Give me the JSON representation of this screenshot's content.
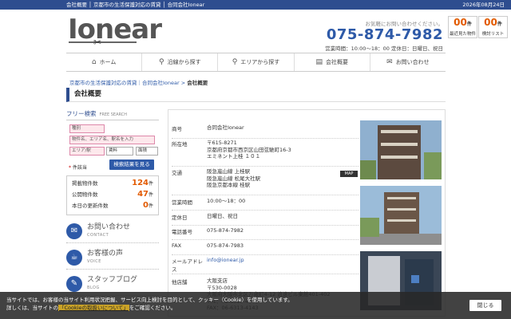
{
  "topbar": {
    "links": "会社概要 │ 京都市の生活保護対応の賃貸 │ 合同会社Ionear",
    "date": "2026年08月24日"
  },
  "logo": {
    "text": "Ionear"
  },
  "contact": {
    "pre": "お気軽にお問い合わせください。",
    "phone": "075-874-7982",
    "hours": "営業時間：10:00〜18：00 定休日：日曜日、祝日"
  },
  "header_buttons": [
    {
      "count": "00",
      "unit": "件",
      "label": "最近見た物件"
    },
    {
      "count": "00",
      "unit": "件",
      "label": "検討リスト"
    }
  ],
  "nav": [
    {
      "label": "ホーム",
      "icon": "home-icon"
    },
    {
      "label": "沿線から探す",
      "icon": "search-icon"
    },
    {
      "label": "エリアから探す",
      "icon": "search-icon"
    },
    {
      "label": "会社概要",
      "icon": "building-icon"
    },
    {
      "label": "お問い合わせ",
      "icon": "mail-icon"
    }
  ],
  "breadcrumb": {
    "link": "京都市の生活保護対応の賃貸｜合同会社Ionear",
    "sep": ">",
    "current": "会社概要"
  },
  "page_title": "会社概要",
  "search": {
    "title": "フリー検索",
    "title_en": "FREE SEARCH",
    "type_ph": "種別",
    "keyword_ph": "物件名、エリア名、駅名を入力",
    "area_ph": "エリア/駅",
    "rent": "賃料",
    "layout": "面積",
    "required_mark": "*",
    "required": "件該当",
    "button": "検索結果を見る"
  },
  "stats": [
    {
      "label": "掲載物件数",
      "value": "124",
      "unit": "件"
    },
    {
      "label": "公開物件数",
      "value": "47",
      "unit": "件"
    },
    {
      "label": "本日の更新件数",
      "value": "0",
      "unit": "件"
    }
  ],
  "side_links": [
    {
      "title": "お問い合わせ",
      "sub": "CONTACT",
      "icon": "mail-icon"
    },
    {
      "title": "お客様の声",
      "sub": "VOICE",
      "icon": "chat-icon"
    },
    {
      "title": "スタッフブログ",
      "sub": "BLOG",
      "icon": "blog-icon"
    }
  ],
  "info": [
    {
      "k": "商号",
      "v": "合同会社Ionear"
    },
    {
      "k": "所在地",
      "v": "〒615-8271\n京都府京都市西京区山田弦馳町16-3\nエミネント上桂 １０１"
    },
    {
      "k": "交通",
      "v": "阪急嵐山線 上桂駅\n阪急嵐山線 松尾大社駅\n阪急京都本線 桂駅"
    },
    {
      "k": "営業時間",
      "v": "10:00〜18：00"
    },
    {
      "k": "定休日",
      "v": "日曜日、祝日"
    },
    {
      "k": "電話番号",
      "v": "075-874-7982"
    },
    {
      "k": "FAX",
      "v": "075-874-7983"
    },
    {
      "k": "メールアドレス",
      "v": "info@ionear.jp"
    },
    {
      "k": "他店舗",
      "v": "大阪支店\n〒530-0028\n大阪府大阪市北区万歳町4-12 浪速ビル東館401-402\nTEL：06-6313-4141\nFAX：06-6313-4143"
    }
  ],
  "map_label": "MAP",
  "cookie": {
    "line1": "当サイトでは、お客様の当サイト利用状況把握、サービス向上検討を目的として、クッキー（Cookie）を使用しています。",
    "line2_pre": "詳しくは、当サイトの",
    "line2_link": "「Cookieの取扱いについて」",
    "line2_post": "をご確認ください。",
    "close": "閉じる"
  },
  "colors": {
    "brand": "#2e4d8f",
    "accent": "#e25a00",
    "phone": "#2e5aa8"
  }
}
